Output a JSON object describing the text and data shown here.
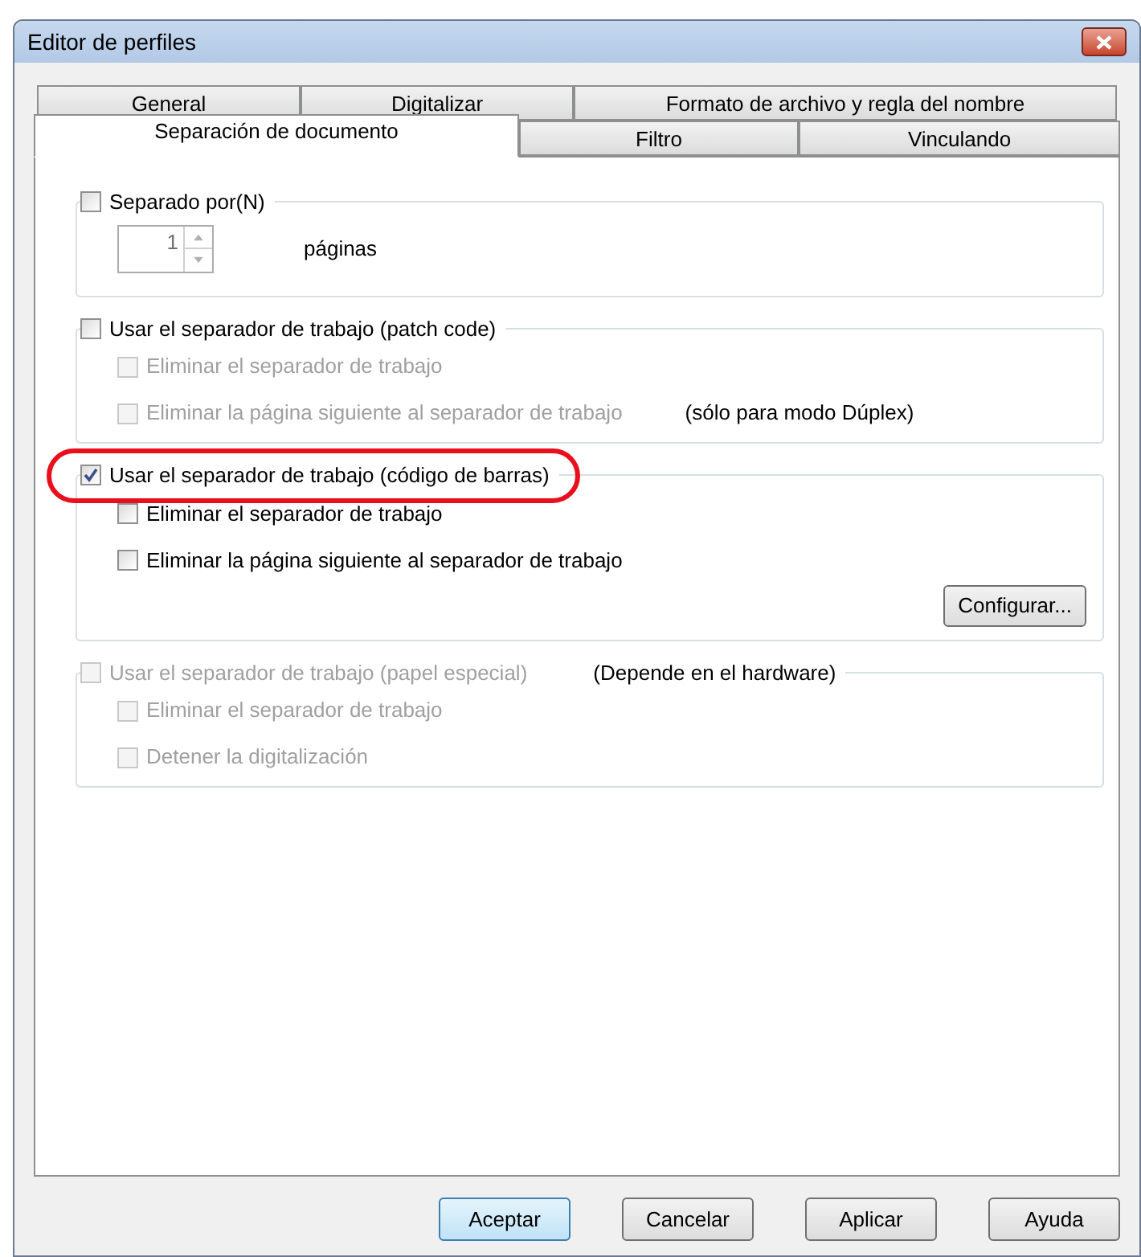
{
  "window": {
    "title": "Editor de perfiles"
  },
  "tab_rows": [
    [
      {
        "label": "General",
        "selected": false
      },
      {
        "label": "Digitalizar",
        "selected": false
      },
      {
        "label": "Formato de archivo y regla del nombre",
        "selected": false
      }
    ],
    [
      {
        "label": "Separación de documento",
        "selected": true
      },
      {
        "label": "Filtro",
        "selected": false
      },
      {
        "label": "Vinculando",
        "selected": false
      }
    ]
  ],
  "groups": [
    {
      "header": {
        "label": "Separado por(N)",
        "checked": false,
        "disabled": false
      },
      "highlighted": false,
      "items": [
        {
          "kind": "spinner",
          "value": "1",
          "unit": "páginas"
        }
      ]
    },
    {
      "header": {
        "label": "Usar el separador de trabajo (patch code)",
        "checked": false,
        "disabled": false
      },
      "highlighted": false,
      "items": [
        {
          "kind": "checkbox",
          "label": "Eliminar el separador de trabajo",
          "checked": false,
          "disabled": true
        },
        {
          "kind": "checkbox",
          "label": "Eliminar la página siguiente al separador de trabajo",
          "checked": false,
          "disabled": true,
          "note": "(sólo para modo Dúplex)"
        }
      ]
    },
    {
      "header": {
        "label": "Usar el separador de trabajo (código de barras)",
        "checked": true,
        "disabled": false
      },
      "highlighted": true,
      "items": [
        {
          "kind": "checkbox",
          "label": "Eliminar el separador de trabajo",
          "checked": false,
          "disabled": false
        },
        {
          "kind": "checkbox",
          "label": "Eliminar la página siguiente al separador de trabajo",
          "checked": false,
          "disabled": false
        },
        {
          "kind": "button",
          "label": "Configurar..."
        }
      ]
    },
    {
      "header": {
        "label": "Usar el separador de trabajo (papel especial)",
        "checked": false,
        "disabled": true,
        "note": "(Depende en el hardware)"
      },
      "highlighted": false,
      "items": [
        {
          "kind": "checkbox",
          "label": "Eliminar el separador de trabajo",
          "checked": false,
          "disabled": true
        },
        {
          "kind": "checkbox",
          "label": "Detener la digitalización",
          "checked": false,
          "disabled": true
        }
      ]
    }
  ],
  "buttons": [
    {
      "label": "Aceptar",
      "default": true
    },
    {
      "label": "Cancelar",
      "default": false
    },
    {
      "label": "Aplicar",
      "default": false
    },
    {
      "label": "Ayuda",
      "default": false
    }
  ]
}
